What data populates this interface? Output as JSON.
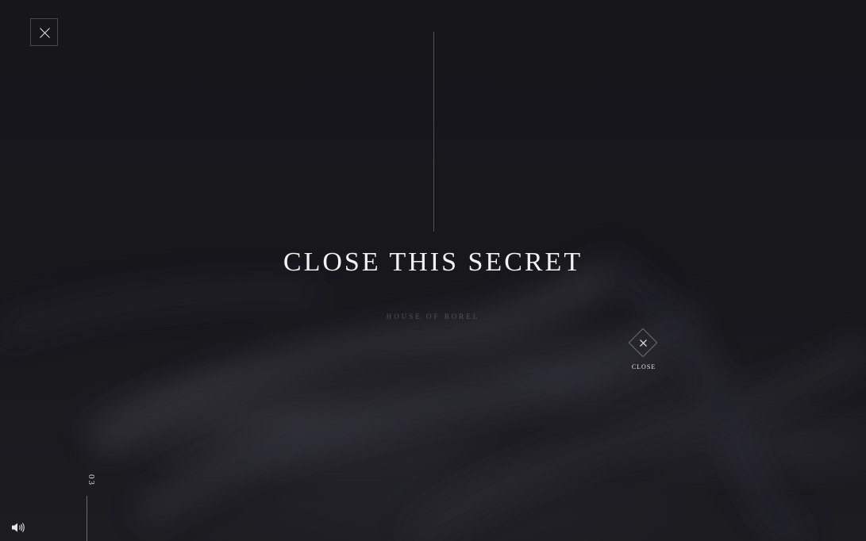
{
  "header": {
    "close_icon": "close-icon"
  },
  "main": {
    "title": "CLOSE THIS SECRET",
    "subtitle": "HOUSE OF BOREL"
  },
  "close_button": {
    "icon": "close-icon",
    "label": "CLOSE"
  },
  "footer": {
    "page_number": "03",
    "sound_icon": "speaker-icon"
  },
  "colors": {
    "background": "#16161b",
    "text": "#f2f2f2",
    "muted": "#4a4a52"
  }
}
